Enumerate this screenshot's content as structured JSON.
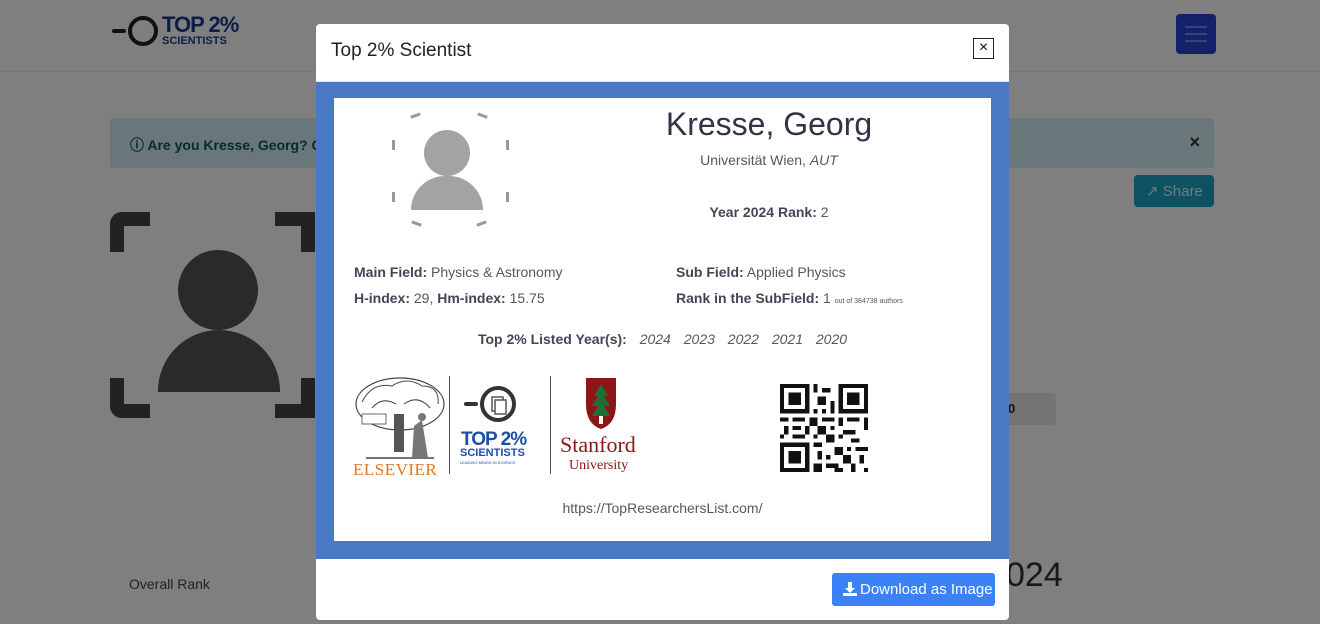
{
  "background": {
    "logo": {
      "line1": "TOP 2%",
      "line2": "SCIENTISTS"
    },
    "alert": {
      "text": "Are you Kresse, Georg? C",
      "close": "×"
    },
    "share_button": "Share",
    "rank_pill": "0",
    "overall_rank_label": "Overall Rank",
    "year_big": "024"
  },
  "modal": {
    "title": "Top 2% Scientist",
    "close": "×",
    "download_button": "Download as Image"
  },
  "card": {
    "name": "Kresse, Georg",
    "institution": "Universität Wien,",
    "country": "AUT",
    "year_rank_label": "Year 2024 Rank:",
    "year_rank_value": "2",
    "main_field_label": "Main Field:",
    "main_field_value": "Physics & Astronomy",
    "sub_field_label": "Sub Field:",
    "sub_field_value": "Applied Physics",
    "h_index_label": "H-index:",
    "h_index_value": "29,",
    "hm_index_label": "Hm-index:",
    "hm_index_value": "15.75",
    "subfield_rank_label": "Rank in the SubField:",
    "subfield_rank_value": "1",
    "subfield_rank_total": "out of 384738 authors",
    "listed_label": "Top 2% Listed Year(s):",
    "listed_years": [
      "2024",
      "2023",
      "2022",
      "2021",
      "2020"
    ],
    "logos": {
      "elsevier": "ELSEVIER",
      "top2_line1": "TOP 2%",
      "top2_line2": "SCIENTISTS",
      "top2_tag": "LEADING MINDS IN SCIENCE",
      "stanford": "Stanford",
      "stanford_sub": "University"
    },
    "url": "https://TopResearchersList.com/"
  },
  "colors": {
    "card_border": "#4a78c4",
    "download_button": "#3b82f6",
    "stanford_red": "#8c1515",
    "elsevier_orange": "#e6761e"
  }
}
